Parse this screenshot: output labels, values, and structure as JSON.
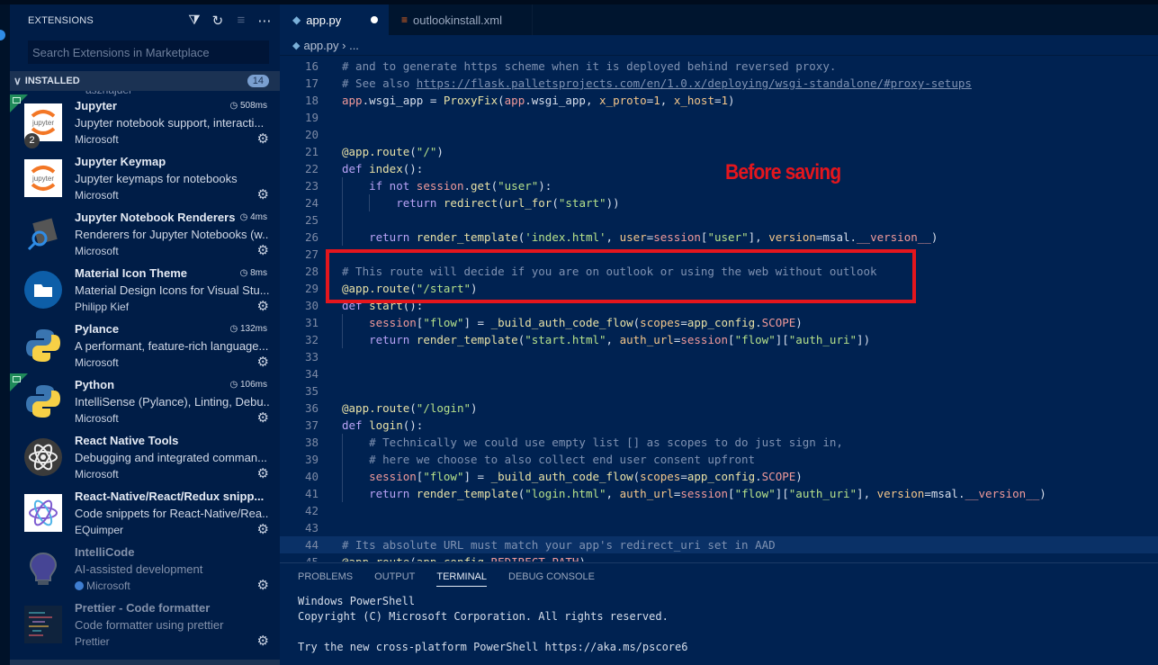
{
  "sidebar": {
    "title": "EXTENSIONS",
    "actions": [
      "filter-icon",
      "refresh-icon",
      "clear-icon",
      "more-icon"
    ],
    "search_placeholder": "Search Extensions in Marketplace",
    "section": {
      "label": "INSTALLED",
      "count": "14"
    },
    "peek_text": "aszhajder",
    "extensions": [
      {
        "name": "Jupyter",
        "timing": "508ms",
        "description": "Jupyter notebook support, interacti...",
        "publisher": "Microsoft",
        "badge": "2",
        "corner": true,
        "disabled": false
      },
      {
        "name": "Jupyter Keymap",
        "timing": "",
        "description": "Jupyter keymaps for notebooks",
        "publisher": "Microsoft",
        "corner": false,
        "disabled": false
      },
      {
        "name": "Jupyter Notebook Renderers",
        "timing": "4ms",
        "description": "Renderers for Jupyter Notebooks (w...",
        "publisher": "Microsoft",
        "corner": false,
        "disabled": false
      },
      {
        "name": "Material Icon Theme",
        "timing": "8ms",
        "description": "Material Design Icons for Visual Stu...",
        "publisher": "Philipp Kief",
        "corner": false,
        "disabled": false
      },
      {
        "name": "Pylance",
        "timing": "132ms",
        "description": "A performant, feature-rich language...",
        "publisher": "Microsoft",
        "corner": false,
        "disabled": false
      },
      {
        "name": "Python",
        "timing": "106ms",
        "description": "IntelliSense (Pylance), Linting, Debu...",
        "publisher": "Microsoft",
        "corner": true,
        "disabled": false
      },
      {
        "name": "React Native Tools",
        "timing": "",
        "description": "Debugging and integrated comman...",
        "publisher": "Microsoft",
        "corner": false,
        "disabled": false
      },
      {
        "name": "React-Native/React/Redux snipp...",
        "timing": "",
        "description": "Code snippets for React-Native/Rea...",
        "publisher": "EQuimper",
        "corner": false,
        "disabled": false
      },
      {
        "name": "IntelliCode",
        "timing": "",
        "description": "AI-assisted development",
        "publisher": "Microsoft",
        "verified": true,
        "corner": false,
        "disabled": true
      },
      {
        "name": "Prettier - Code formatter",
        "timing": "",
        "description": "Code formatter using prettier",
        "publisher": "Prettier",
        "corner": false,
        "disabled": true
      }
    ]
  },
  "editor": {
    "tabs": [
      {
        "label": "app.py",
        "active": true,
        "dirty": true
      },
      {
        "label": "outlookinstall.xml",
        "active": false,
        "dirty": false
      }
    ],
    "breadcrumb": {
      "file": "app.py",
      "rest": "..."
    },
    "annotation": "Before saving",
    "lines": [
      {
        "n": "16",
        "html": "<span class='c-com'># and to generate https scheme when it is deployed behind reversed proxy.</span>"
      },
      {
        "n": "17",
        "html": "<span class='c-com'># See also </span><span class='c-link'>https://flask.palletsprojects.com/en/1.0.x/deploying/wsgi-standalone/#proxy-setups</span>"
      },
      {
        "n": "18",
        "html": "<span class='c-var'>app</span>.wsgi_app = <span class='c-fn'>ProxyFix</span>(<span class='c-var'>app</span>.wsgi_app, <span class='c-par'>x_proto</span>=<span class='c-num'>1</span>, <span class='c-par'>x_host</span>=<span class='c-num'>1</span>)"
      },
      {
        "n": "19",
        "html": ""
      },
      {
        "n": "20",
        "html": ""
      },
      {
        "n": "21",
        "html": "<span class='c-fn'>@app.route</span>(<span class='c-str'>\"/\"</span>)"
      },
      {
        "n": "22",
        "html": "<span class='c-kw'>def</span> <span class='c-fn'>index</span>():"
      },
      {
        "n": "23",
        "html": "    <span class='c-kw'>if not</span> <span class='c-var'>session</span>.<span class='c-fn'>get</span>(<span class='c-str'>\"user\"</span>):"
      },
      {
        "n": "24",
        "html": "        <span class='c-kw'>return</span> <span class='c-fn'>redirect</span>(<span class='c-fn'>url_for</span>(<span class='c-str'>\"start\"</span>))"
      },
      {
        "n": "25",
        "html": ""
      },
      {
        "n": "26",
        "html": "    <span class='c-kw'>return</span> <span class='c-fn'>render_template</span>(<span class='c-str'>'index.html'</span>, <span class='c-par'>user</span>=<span class='c-var'>session</span>[<span class='c-str'>\"user\"</span>], <span class='c-par'>version</span>=msal.<span class='c-var'>__version__</span>)"
      },
      {
        "n": "27",
        "html": ""
      },
      {
        "n": "28",
        "html": "<span class='c-com'># This route will decide if you are on outlook or using the web without outlook</span>"
      },
      {
        "n": "29",
        "html": "<span class='c-fn'>@app.route</span>(<span class='c-str'>\"/start\"</span>)"
      },
      {
        "n": "30",
        "html": "<span class='c-kw'>def</span> <span class='c-fn'>start</span>():"
      },
      {
        "n": "31",
        "html": "    <span class='c-var'>session</span>[<span class='c-str'>\"flow\"</span>] = <span class='c-fn'>_build_auth_code_flow</span>(<span class='c-par'>scopes</span>=<span class='c-fn'>app_config</span>.<span class='c-var'>SCOPE</span>)"
      },
      {
        "n": "32",
        "html": "    <span class='c-kw'>return</span> <span class='c-fn'>render_template</span>(<span class='c-str'>\"start.html\"</span>, <span class='c-par'>auth_url</span>=<span class='c-var'>session</span>[<span class='c-str'>\"flow\"</span>][<span class='c-str'>\"auth_uri\"</span>])"
      },
      {
        "n": "33",
        "html": ""
      },
      {
        "n": "34",
        "html": ""
      },
      {
        "n": "35",
        "html": ""
      },
      {
        "n": "36",
        "html": "<span class='c-fn'>@app.route</span>(<span class='c-str'>\"/login\"</span>)"
      },
      {
        "n": "37",
        "html": "<span class='c-kw'>def</span> <span class='c-fn'>login</span>():"
      },
      {
        "n": "38",
        "html": "    <span class='c-com'># Technically we could use empty list [] as scopes to do just sign in,</span>"
      },
      {
        "n": "39",
        "html": "    <span class='c-com'># here we choose to also collect end user consent upfront</span>"
      },
      {
        "n": "40",
        "html": "    <span class='c-var'>session</span>[<span class='c-str'>\"flow\"</span>] = <span class='c-fn'>_build_auth_code_flow</span>(<span class='c-par'>scopes</span>=<span class='c-fn'>app_config</span>.<span class='c-var'>SCOPE</span>)"
      },
      {
        "n": "41",
        "html": "    <span class='c-kw'>return</span> <span class='c-fn'>render_template</span>(<span class='c-str'>\"login.html\"</span>, <span class='c-par'>auth_url</span>=<span class='c-var'>session</span>[<span class='c-str'>\"flow\"</span>][<span class='c-str'>\"auth_uri\"</span>], <span class='c-par'>version</span>=msal.<span class='c-var'>__version__</span>)"
      },
      {
        "n": "42",
        "html": ""
      },
      {
        "n": "43",
        "html": ""
      },
      {
        "n": "44",
        "html": "<span class='c-com'># Its absolute URL must match your app's redirect_uri set in AAD</span>",
        "highlight": true
      },
      {
        "n": "45",
        "html": "<span class='c-fn'>@app.route</span>(<span class='c-fn'>app_config</span>.<span class='c-var'>REDIRECT_PATH</span>)"
      }
    ]
  },
  "panel": {
    "tabs": [
      {
        "label": "PROBLEMS",
        "active": false
      },
      {
        "label": "OUTPUT",
        "active": false
      },
      {
        "label": "TERMINAL",
        "active": true
      },
      {
        "label": "DEBUG CONSOLE",
        "active": false
      }
    ],
    "terminal_lines": [
      "Windows PowerShell",
      "Copyright (C) Microsoft Corporation. All rights reserved.",
      "",
      "Try the new cross-platform PowerShell https://aka.ms/pscore6"
    ]
  }
}
